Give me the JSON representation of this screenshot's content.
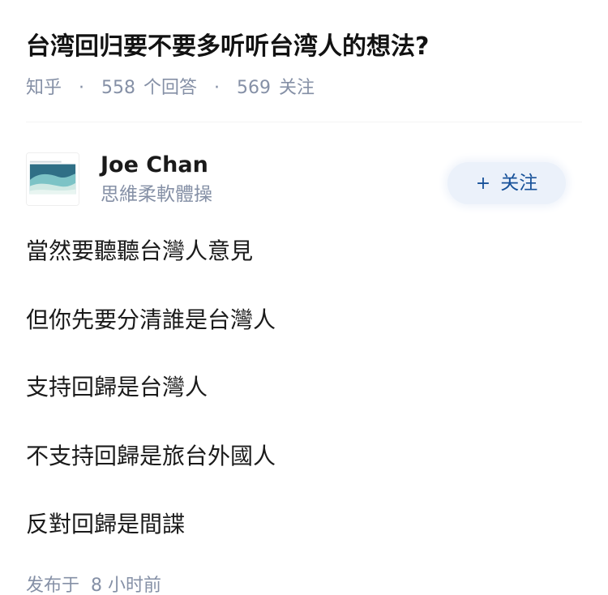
{
  "question": {
    "title": "台湾回归要不要多听听台湾人的想法?",
    "source": "知乎",
    "answer_count": "558",
    "answer_label": "个回答",
    "follower_count": "569",
    "follower_label": "关注"
  },
  "author": {
    "name": "Joe Chan",
    "bio": "思維柔軟體操",
    "follow_label": "关注",
    "follow_icon": "plus-icon"
  },
  "answer": {
    "lines": [
      "當然要聽聽台灣人意見",
      "但你先要分清誰是台灣人",
      "支持回歸是台灣人",
      "不支持回歸是旅台外國人",
      "反對回歸是間諜"
    ]
  },
  "footer": {
    "published_label": "发布于",
    "published_time": "8 小时前"
  },
  "colors": {
    "title": "#121212",
    "meta": "#8590a6",
    "follow_bg": "#ebf1fa",
    "follow_text": "#175199"
  }
}
